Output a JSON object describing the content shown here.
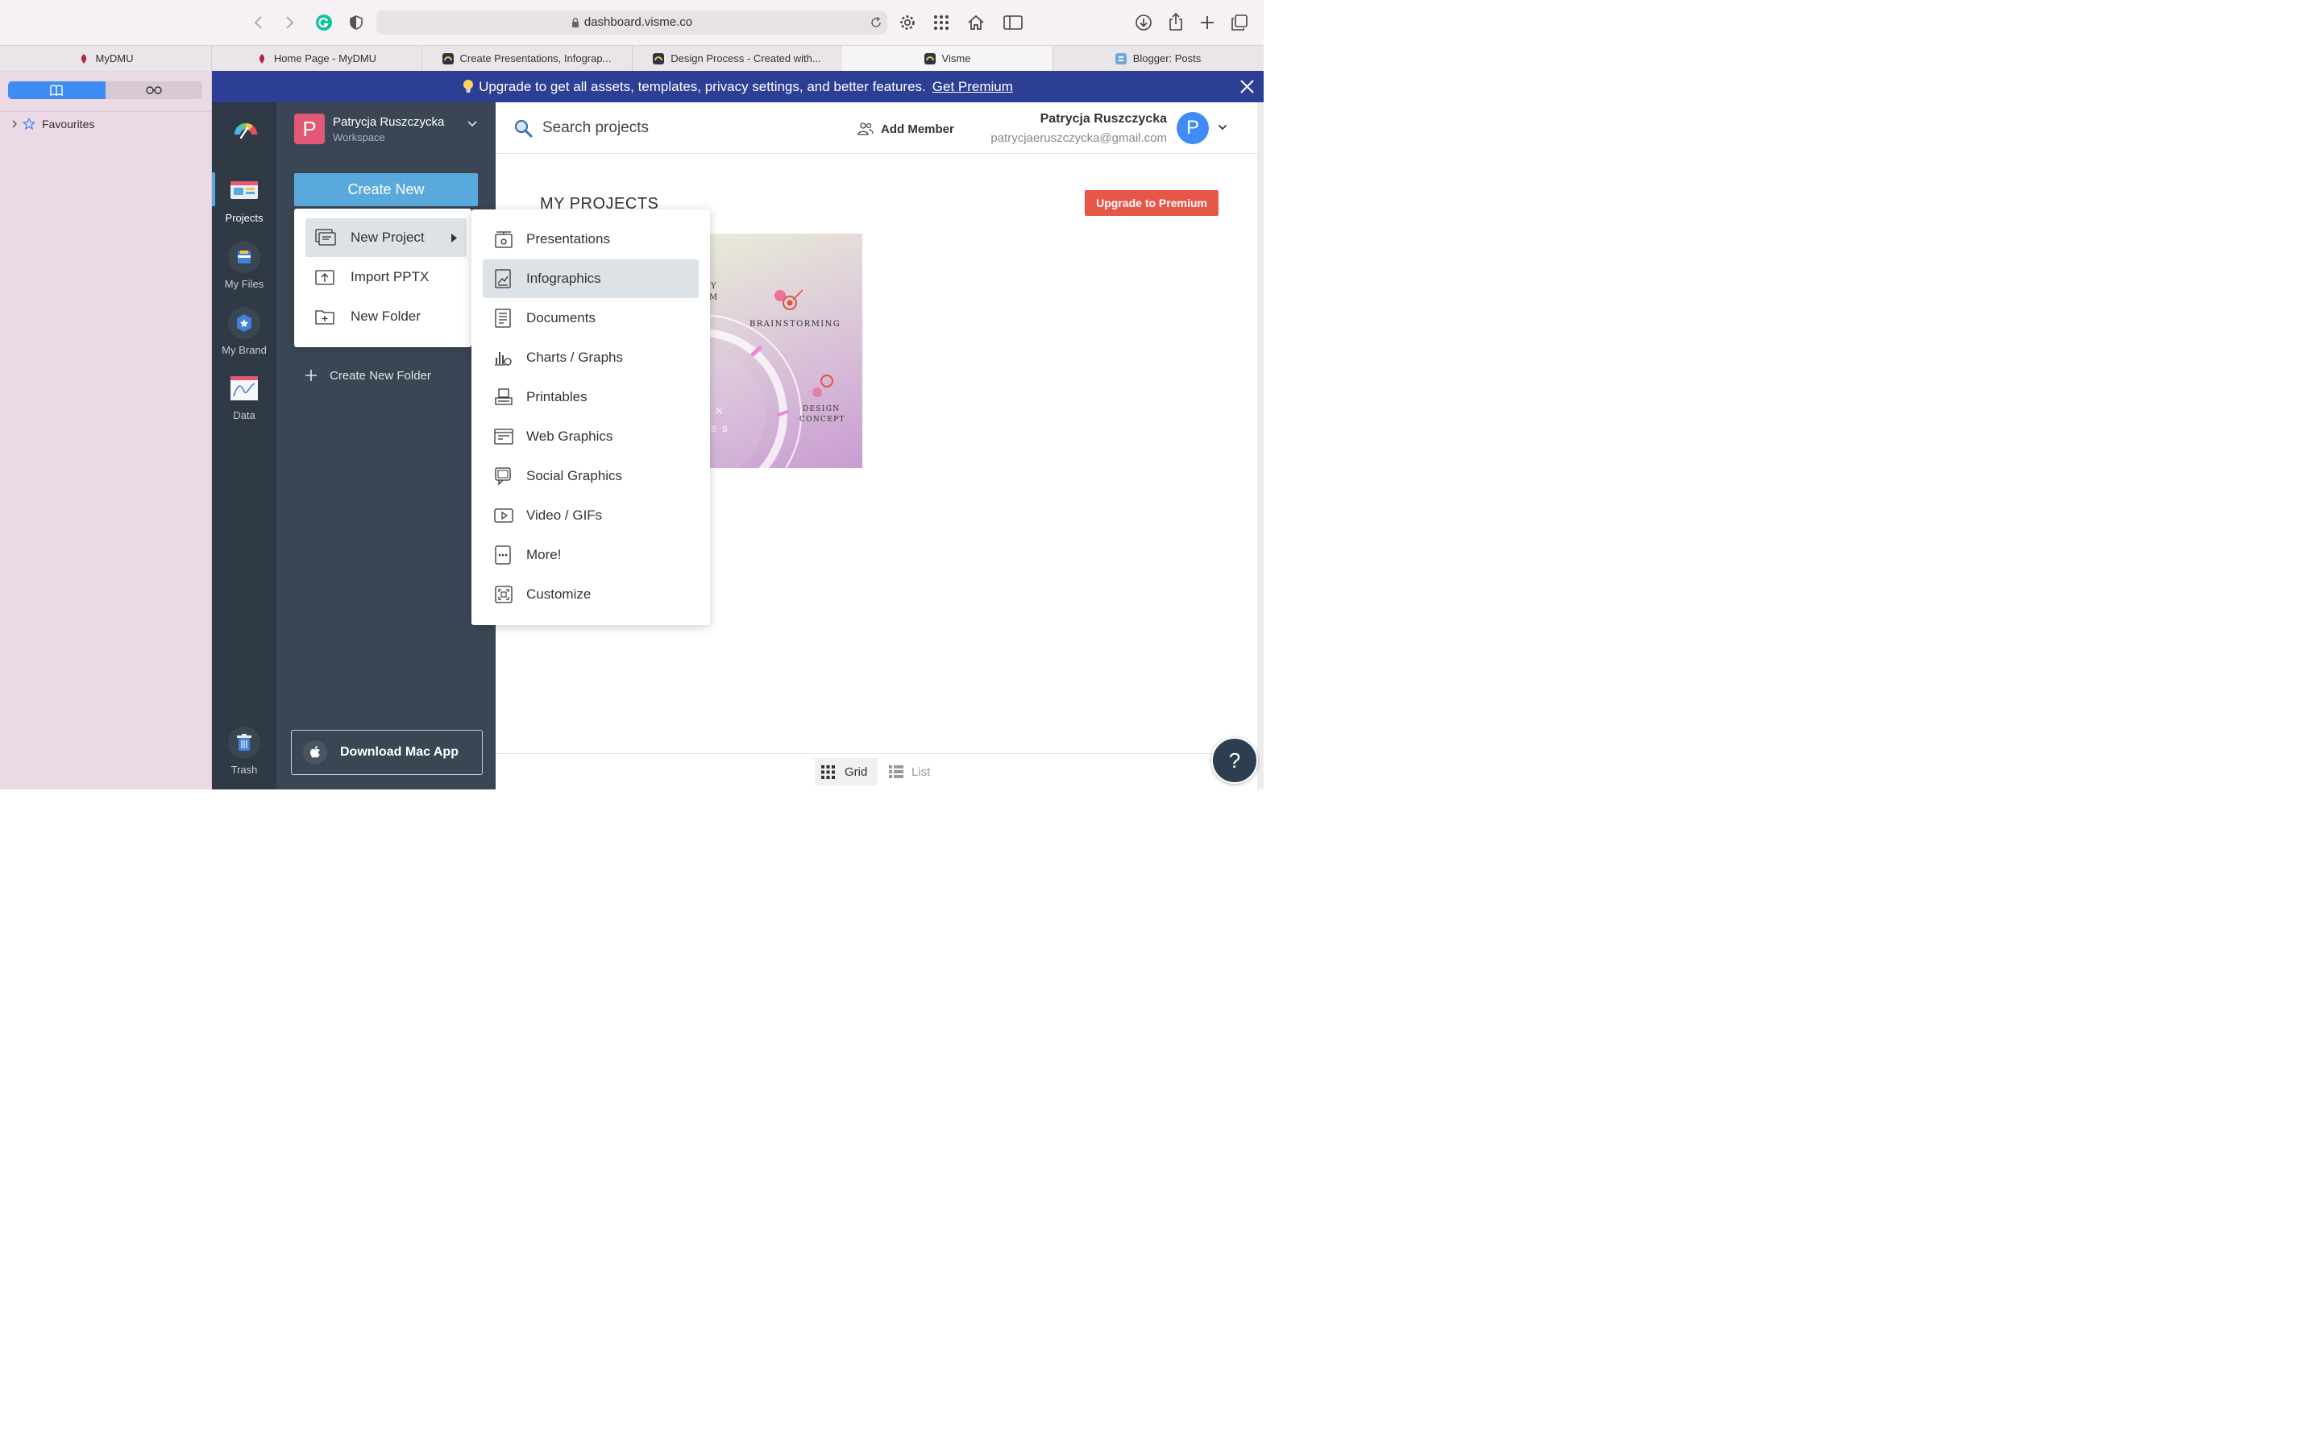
{
  "browser": {
    "url": "dashboard.visme.co",
    "tabs": [
      {
        "label": "MyDMU"
      },
      {
        "label": "Home Page - MyDMU"
      },
      {
        "label": "Create Presentations, Infograp..."
      },
      {
        "label": "Design Process - Created with..."
      },
      {
        "label": "Visme"
      },
      {
        "label": "Blogger: Posts"
      }
    ],
    "sidebar": {
      "favourites_label": "Favourites"
    }
  },
  "banner": {
    "text": "Upgrade to get all assets, templates, privacy settings, and better features.",
    "link": "Get Premium"
  },
  "nav": {
    "items": [
      {
        "label": "Projects"
      },
      {
        "label": "My Files"
      },
      {
        "label": "My Brand"
      },
      {
        "label": "Data"
      },
      {
        "label": "Trash"
      }
    ]
  },
  "workspace": {
    "avatar_letter": "P",
    "name": "Patrycja Ruszczycka",
    "subtitle": "Workspace",
    "create_label": "Create New",
    "create_folder_label": "Create New Folder",
    "download_label": "Download Mac App"
  },
  "header": {
    "search_placeholder": "Search projects",
    "add_member": "Add Member",
    "user_name": "Patrycja Ruszczycka",
    "user_email": "patrycjaeruszczycka@gmail.com",
    "avatar_letter": "P"
  },
  "main": {
    "section_title": "MY PROJECTS",
    "upgrade_label": "Upgrade to Premium",
    "thumbnail": {
      "text_brainstorming": "BRAINSTORMING",
      "text_design": "DESIGN",
      "text_concept": "CONCEPT",
      "text_y": "Y",
      "text_m": "M",
      "text_n": "N",
      "text_ss": "S S"
    },
    "view_grid": "Grid",
    "view_list": "List"
  },
  "create_menu": {
    "items": [
      {
        "label": "New Project"
      },
      {
        "label": "Import PPTX"
      },
      {
        "label": "New Folder"
      }
    ]
  },
  "project_types": {
    "items": [
      {
        "label": "Presentations"
      },
      {
        "label": "Infographics"
      },
      {
        "label": "Documents"
      },
      {
        "label": "Charts / Graphs"
      },
      {
        "label": "Printables"
      },
      {
        "label": "Web Graphics"
      },
      {
        "label": "Social Graphics"
      },
      {
        "label": "Video / GIFs"
      },
      {
        "label": "More!"
      },
      {
        "label": "Customize"
      }
    ]
  },
  "help_label": "?",
  "colors": {
    "banner": "#2d3f95",
    "create_button": "#5aa9dc",
    "upgrade_button": "#e6574a",
    "nav_bg": "#2f3a46",
    "workspace_bg": "#3b4654"
  }
}
